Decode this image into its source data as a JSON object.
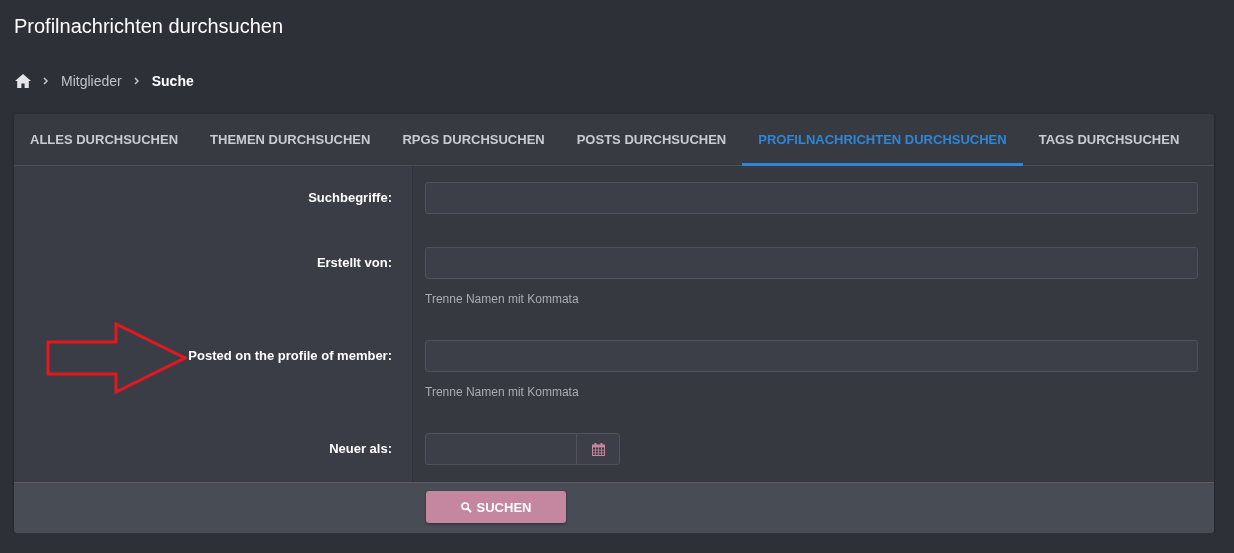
{
  "page": {
    "title": "Profilnachrichten durchsuchen"
  },
  "breadcrumb": [
    {
      "kind": "home"
    },
    {
      "kind": "link",
      "label": "Mitglieder",
      "current": false
    },
    {
      "kind": "link",
      "label": "Suche",
      "current": true
    }
  ],
  "tabs": [
    {
      "label": "ALLES DURCHSUCHEN",
      "selected": false
    },
    {
      "label": "THEMEN DURCHSUCHEN",
      "selected": false
    },
    {
      "label": "RPGS DURCHSUCHEN",
      "selected": false
    },
    {
      "label": "POSTS DURCHSUCHEN",
      "selected": false
    },
    {
      "label": "PROFILNACHRICHTEN DURCHSUCHEN",
      "selected": true
    },
    {
      "label": "TAGS DURCHSUCHEN",
      "selected": false
    }
  ],
  "form": {
    "rows": [
      {
        "kind": "text",
        "label": "Suchbegriffe:",
        "annotated": false
      },
      {
        "kind": "text",
        "label": "Erstellt von:",
        "hint": "Trenne Namen mit Kommata",
        "annotated": false
      },
      {
        "kind": "text",
        "label": "Posted on the profile of member:",
        "hint": "Trenne Namen mit Kommata",
        "annotated": true
      },
      {
        "kind": "date",
        "label": "Neuer als:",
        "annotated": false
      }
    ]
  },
  "submit": {
    "label": "SUCHEN"
  }
}
